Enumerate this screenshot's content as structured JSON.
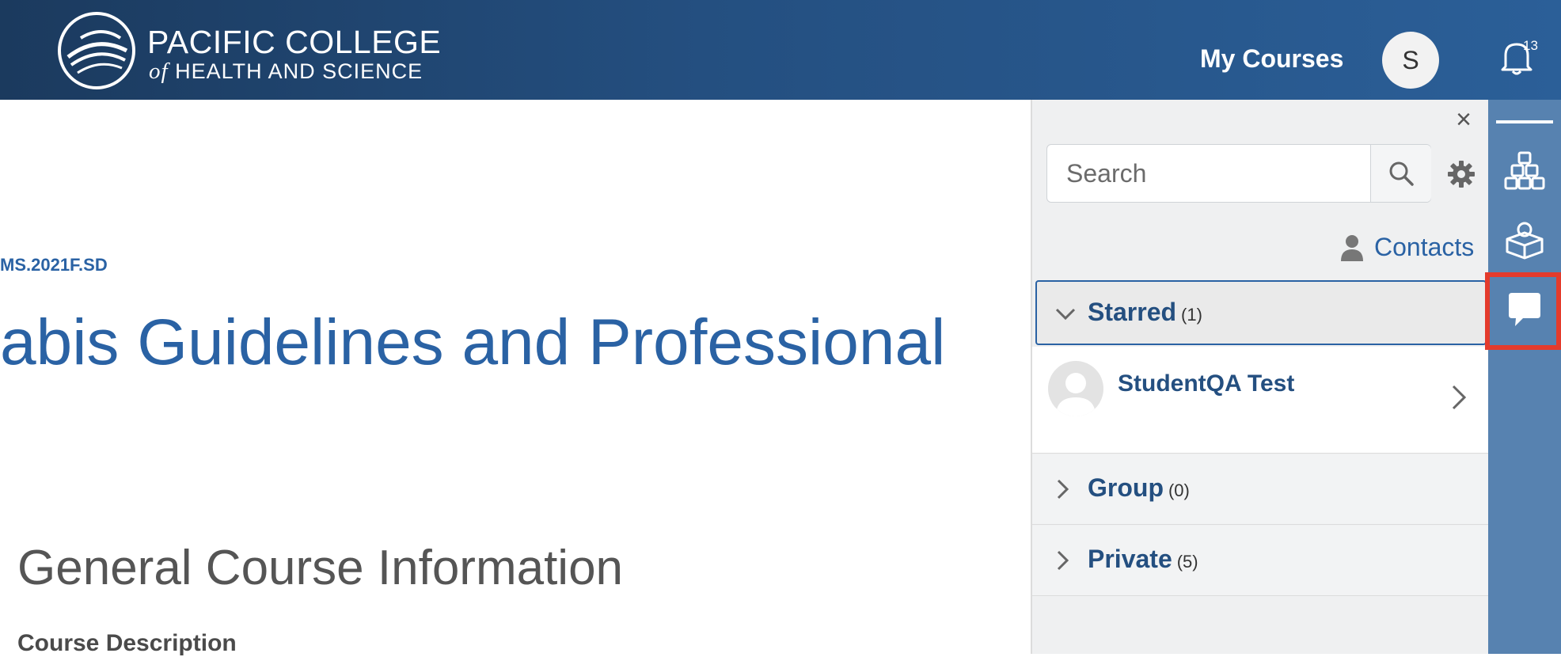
{
  "header": {
    "logo_line1": "PACIFIC COLLEGE",
    "logo_line2_prefix": "of",
    "logo_line2_rest": "HEALTH AND SCIENCE",
    "my_courses": "My Courses",
    "avatar_initial": "S",
    "notification_count": "13"
  },
  "main": {
    "course_code": "MS.2021F.SD",
    "course_title": "abis Guidelines and Professional",
    "section_heading": "General Course Information",
    "sub_heading": "Course Description"
  },
  "drawer": {
    "search_placeholder": "Search",
    "contacts_label": "Contacts",
    "sections": [
      {
        "label": "Starred",
        "count": "(1)"
      },
      {
        "label": "Group",
        "count": "(0)"
      },
      {
        "label": "Private",
        "count": "(5)"
      }
    ],
    "starred_contacts": [
      {
        "name": "StudentQA Test"
      }
    ]
  },
  "colors": {
    "accent": "#2a62a4",
    "rail": "#5782b0",
    "highlight": "#e43b2c"
  }
}
